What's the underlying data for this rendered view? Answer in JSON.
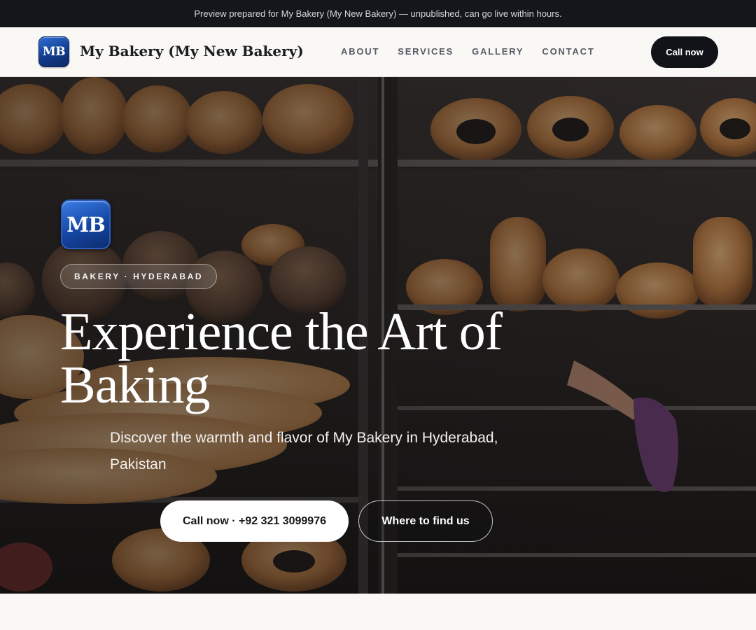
{
  "preview_banner": {
    "text": "Preview prepared for My Bakery (My New Bakery) — unpublished, can go live within hours."
  },
  "header": {
    "logo_text": "MB",
    "brand_name": "My Bakery (My New Bakery)",
    "nav": [
      {
        "label": "ABOUT"
      },
      {
        "label": "SERVICES"
      },
      {
        "label": "GALLERY"
      },
      {
        "label": "CONTACT"
      }
    ],
    "call_button": "Call now"
  },
  "hero": {
    "logo_text": "MB",
    "tag": "BAKERY · HYDERABAD",
    "title": "Experience the Art of Baking",
    "subtitle": "Discover the warmth and flavor of My Bakery in Hyderabad, Pakistan",
    "primary_button": "Call now · +92 321 3099976",
    "secondary_button": "Where to find us",
    "background_image": "bakery-display-shelves-photo"
  },
  "colors": {
    "banner_bg": "#14161c",
    "header_bg": "#faf8f4",
    "dark_button": "#121318",
    "logo_blue": "#1446a3"
  }
}
